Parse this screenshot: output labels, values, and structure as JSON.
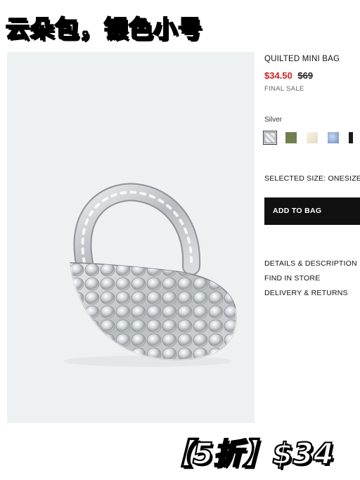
{
  "overlay": {
    "title": "云朵包，银色小号",
    "price_tag": "【5折】$34"
  },
  "product": {
    "name": "QUILTED MINI BAG",
    "sale_price": "$34.50",
    "original_price": "$69",
    "sale_note": "FINAL SALE",
    "color_label": "Silver",
    "swatches": [
      {
        "name": "silver",
        "color": "#d8dcdf",
        "selected": true
      },
      {
        "name": "olive",
        "color": "#6f7f4f",
        "selected": false
      },
      {
        "name": "cream",
        "color": "#efe9d6",
        "selected": false
      },
      {
        "name": "blue",
        "color": "#8ea6cf",
        "selected": false
      },
      {
        "name": "black",
        "color": "#1a1a1a",
        "selected": false
      }
    ],
    "selected_size": "SELECTED SIZE: ONESIZE",
    "add_to_bag_label": "ADD TO BAG",
    "links": [
      "DETAILS & DESCRIPTION",
      "FIND IN STORE",
      "DELIVERY & RETURNS"
    ]
  },
  "colors": {
    "sale_red": "#d0201e",
    "button_black": "#111111",
    "image_bg": "#eef1f2"
  }
}
